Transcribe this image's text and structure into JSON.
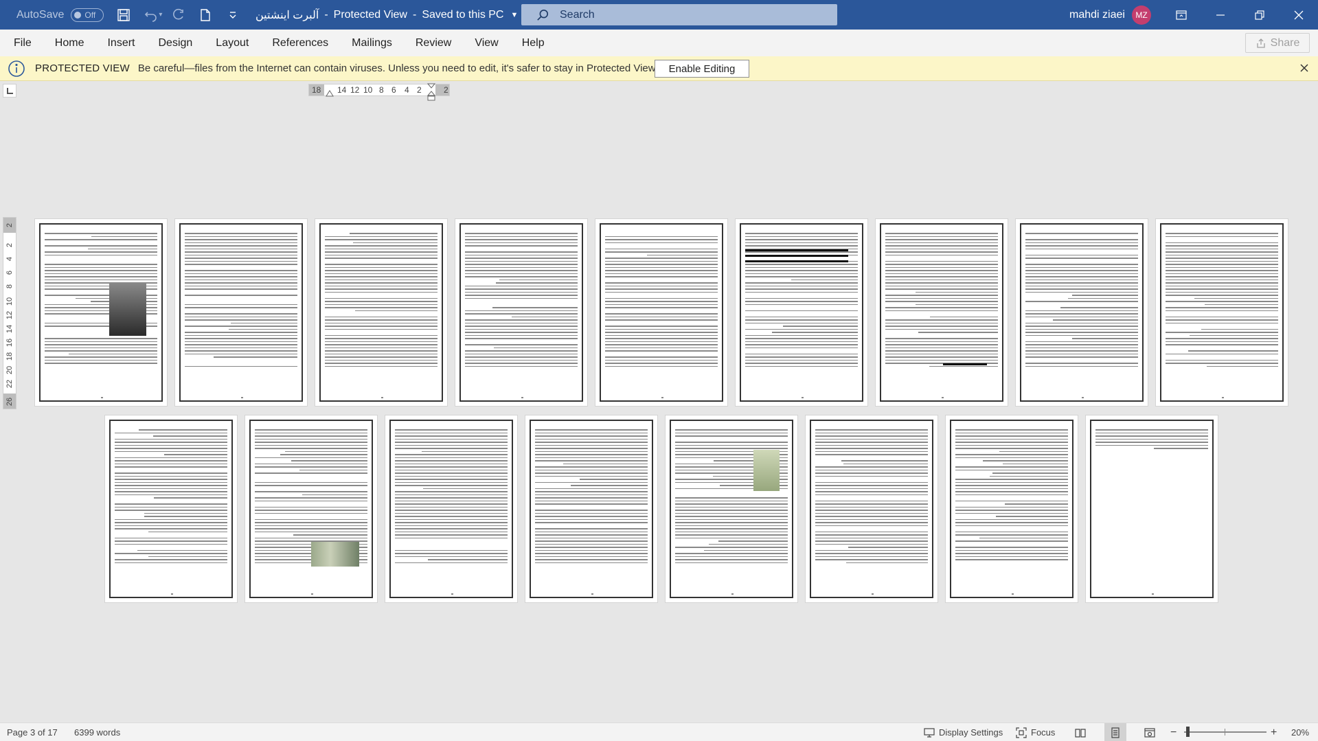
{
  "titlebar": {
    "autosave_label": "AutoSave",
    "autosave_state": "Off",
    "doc_name": "آلبرت اینشتین",
    "separator": "-",
    "view_mode": "Protected View",
    "save_status": "Saved to this PC",
    "search_placeholder": "Search",
    "user_name": "mahdi ziaei",
    "user_initials": "MZ",
    "icons": [
      "save-icon",
      "undo-icon",
      "redo-icon",
      "new-document-icon",
      "customize-toolbar-icon",
      "ribbon-display-icon",
      "minimize-icon",
      "restore-icon",
      "close-icon"
    ],
    "colors": {
      "bar": "#2b579a",
      "avatar": "#c43e6e"
    }
  },
  "menu": {
    "items": [
      "File",
      "Home",
      "Insert",
      "Design",
      "Layout",
      "References",
      "Mailings",
      "Review",
      "View",
      "Help"
    ],
    "share_label": "Share"
  },
  "protected_view": {
    "title": "PROTECTED VIEW",
    "message": "Be careful—files from the Internet can contain viruses. Unless you need to edit, it's safer to stay in Protected View.",
    "button": "Enable Editing",
    "color": "#fcf6c8"
  },
  "ruler": {
    "horizontal": [
      "18",
      "14",
      "12",
      "10",
      "8",
      "6",
      "4",
      "2",
      "2"
    ],
    "vertical": [
      "2",
      "2",
      "4",
      "6",
      "8",
      "10",
      "12",
      "14",
      "16",
      "18",
      "20",
      "22",
      "26"
    ]
  },
  "pages": {
    "total_shown": 17,
    "images": [
      "child-photo",
      "banknote-photo",
      "certificate-image"
    ]
  },
  "statusbar": {
    "page_info": "Page 3 of 17",
    "word_count": "6399 words",
    "display_settings": "Display Settings",
    "focus": "Focus",
    "zoom_minus": "−",
    "zoom_plus": "+",
    "zoom_level": "20%"
  }
}
